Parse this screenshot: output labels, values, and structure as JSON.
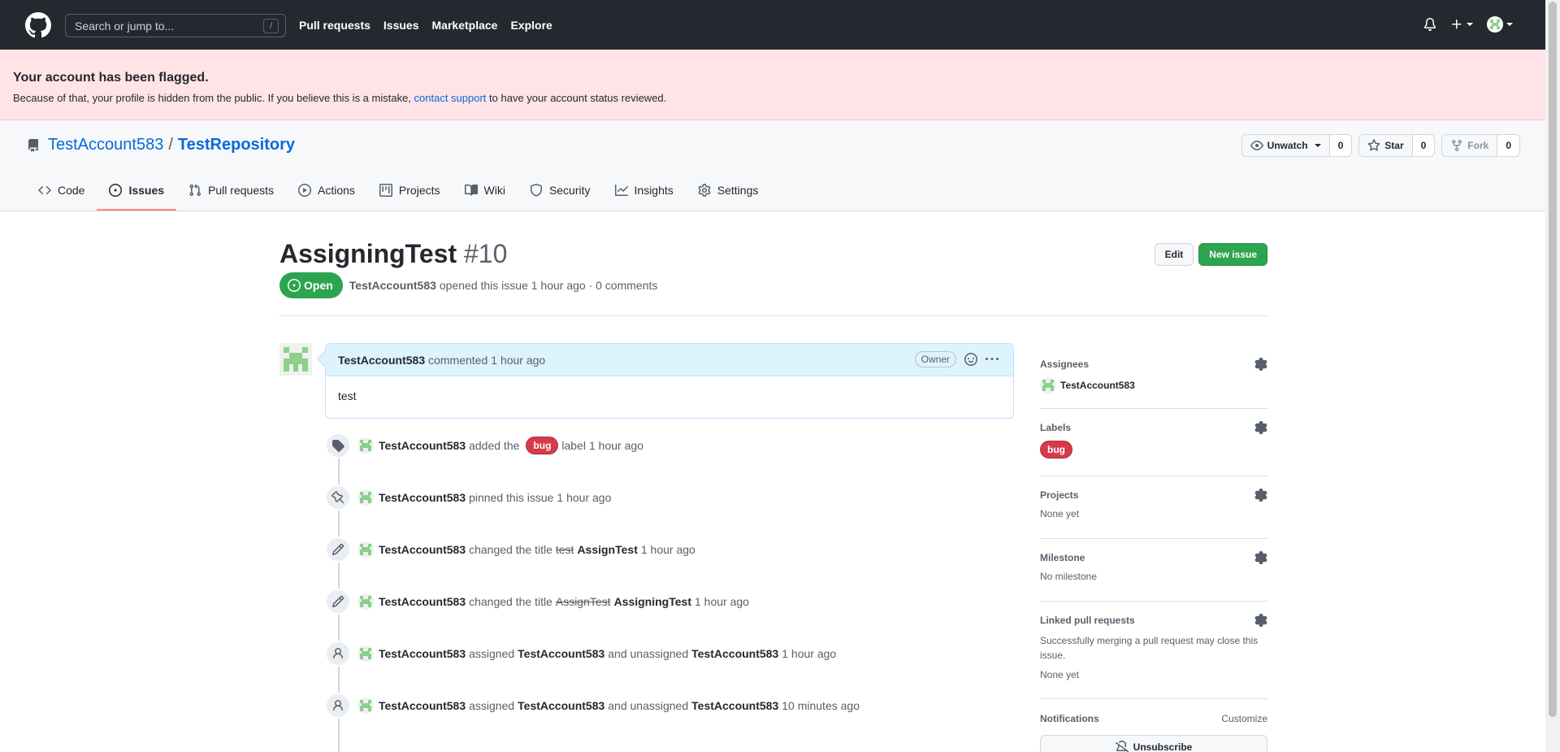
{
  "header": {
    "search_placeholder": "Search or jump to...",
    "search_key": "/",
    "nav": [
      "Pull requests",
      "Issues",
      "Marketplace",
      "Explore"
    ]
  },
  "flash": {
    "title": "Your account has been flagged.",
    "body_before": "Because of that, your profile is hidden from the public. If you believe this is a mistake, ",
    "link": "contact support",
    "body_after": " to have your account status reviewed."
  },
  "repo": {
    "owner": "TestAccount583",
    "separator": "/",
    "name": "TestRepository",
    "watch_label": "Unwatch",
    "watch_count": "0",
    "star_label": "Star",
    "star_count": "0",
    "fork_label": "Fork",
    "fork_count": "0",
    "tabs": [
      "Code",
      "Issues",
      "Pull requests",
      "Actions",
      "Projects",
      "Wiki",
      "Security",
      "Insights",
      "Settings"
    ],
    "active_tab": "Issues"
  },
  "issue": {
    "title": "AssigningTest",
    "number": "#10",
    "state": "Open",
    "author": "TestAccount583",
    "meta": "opened this issue 1 hour ago · 0 comments",
    "edit_label": "Edit",
    "new_issue_label": "New issue"
  },
  "comment": {
    "author": "TestAccount583",
    "action": "commented",
    "time": "1 hour ago",
    "badge": "Owner",
    "body": "test"
  },
  "timeline": [
    {
      "icon": "tag-icon",
      "actor": "TestAccount583",
      "text1": "added the",
      "label": "bug",
      "text2": "label",
      "time": "1 hour ago"
    },
    {
      "icon": "pin-icon",
      "actor": "TestAccount583",
      "text1": "pinned this issue",
      "time": "1 hour ago"
    },
    {
      "icon": "pencil-icon",
      "actor": "TestAccount583",
      "text1": "changed the title",
      "old": "test",
      "new": "AssignTest",
      "time": "1 hour ago"
    },
    {
      "icon": "pencil-icon",
      "actor": "TestAccount583",
      "text1": "changed the title",
      "old": "AssignTest",
      "new": "AssigningTest",
      "time": "1 hour ago"
    },
    {
      "icon": "person-icon",
      "actor": "TestAccount583",
      "text1": "assigned",
      "user1": "TestAccount583",
      "text2": "and unassigned",
      "user2": "TestAccount583",
      "time": "1 hour ago"
    },
    {
      "icon": "person-icon",
      "actor": "TestAccount583",
      "text1": "assigned",
      "user1": "TestAccount583",
      "text2": "and unassigned",
      "user2": "TestAccount583",
      "time": "10 minutes ago"
    }
  ],
  "sidebar": {
    "assignees_title": "Assignees",
    "assignee": "TestAccount583",
    "labels_title": "Labels",
    "label": "bug",
    "projects_title": "Projects",
    "projects_value": "None yet",
    "milestone_title": "Milestone",
    "milestone_value": "No milestone",
    "linked_title": "Linked pull requests",
    "linked_desc": "Successfully merging a pull request may close this issue.",
    "linked_value": "None yet",
    "notifications_title": "Notifications",
    "customize": "Customize",
    "unsubscribe": "Unsubscribe"
  },
  "colors": {
    "header_bg": "#24292f",
    "flash_bg": "#ffe3e6",
    "link": "#0969da",
    "open_green": "#2da44e",
    "bug_label": "#d73a4a",
    "active_tab_underline": "#fd8c73"
  }
}
